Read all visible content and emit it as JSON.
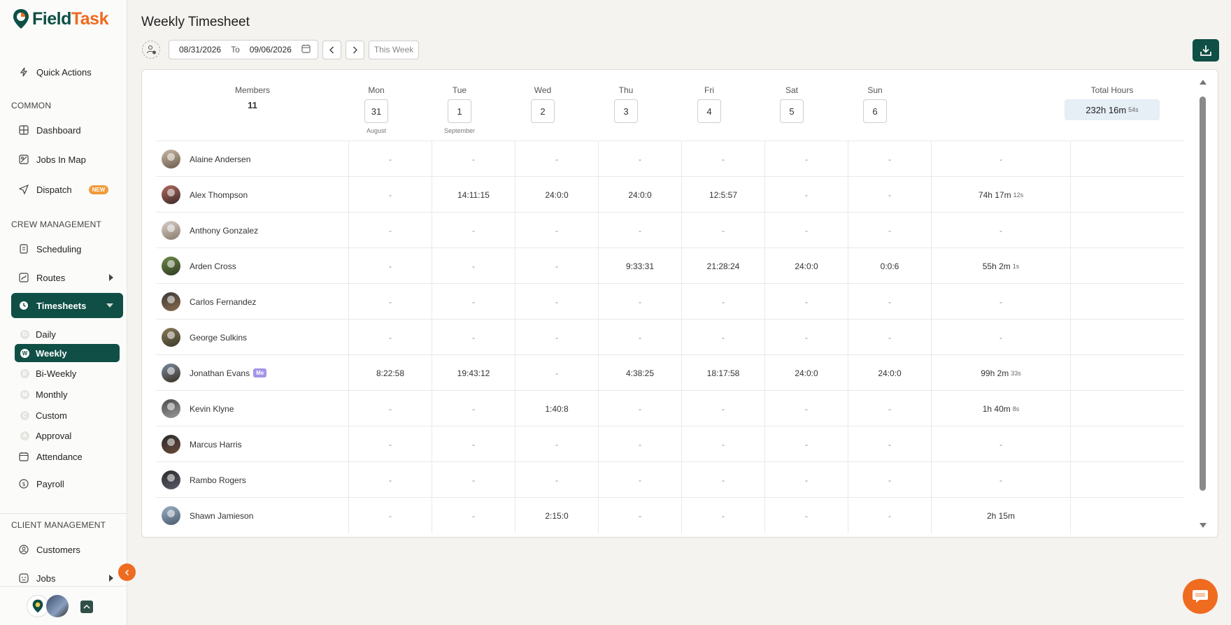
{
  "app": {
    "brand_part1": "Field",
    "brand_part2": "Task"
  },
  "sidebar": {
    "quick_actions": "Quick Actions",
    "section_common": "COMMON",
    "dashboard": "Dashboard",
    "jobs_in_map": "Jobs In Map",
    "dispatch": "Dispatch",
    "dispatch_badge": "NEW",
    "section_crew": "CREW MANAGEMENT",
    "scheduling": "Scheduling",
    "routes": "Routes",
    "timesheets": "Timesheets",
    "timesheet_sub": [
      {
        "letter": "D",
        "label": "Daily"
      },
      {
        "letter": "W",
        "label": "Weekly"
      },
      {
        "letter": "B",
        "label": "Bi-Weekly"
      },
      {
        "letter": "M",
        "label": "Monthly"
      },
      {
        "letter": "C",
        "label": "Custom"
      },
      {
        "letter": "A",
        "label": "Approval"
      }
    ],
    "attendance": "Attendance",
    "payroll": "Payroll",
    "section_client": "CLIENT MANAGEMENT",
    "customers": "Customers",
    "jobs": "Jobs"
  },
  "header": {
    "title": "Weekly Timesheet",
    "date_from": "08/31/2026",
    "to_label": "To",
    "date_to": "09/06/2026",
    "this_week": "This Week"
  },
  "table": {
    "members_label": "Members",
    "members_count": "11",
    "days": [
      {
        "name": "Mon",
        "num": "31",
        "month": "August"
      },
      {
        "name": "Tue",
        "num": "1",
        "month": "September"
      },
      {
        "name": "Wed",
        "num": "2",
        "month": ""
      },
      {
        "name": "Thu",
        "num": "3",
        "month": ""
      },
      {
        "name": "Fri",
        "num": "4",
        "month": ""
      },
      {
        "name": "Sat",
        "num": "5",
        "month": ""
      },
      {
        "name": "Sun",
        "num": "6",
        "month": ""
      }
    ],
    "total_label": "Total Hours",
    "total_main": "232h 16m",
    "total_small": "54s",
    "rows": [
      {
        "name": "Alaine Andersen",
        "me": "",
        "cells": [
          "-",
          "-",
          "-",
          "-",
          "-",
          "-",
          "-"
        ],
        "total": "-",
        "total_small": ""
      },
      {
        "name": "Alex Thompson",
        "me": "",
        "cells": [
          "-",
          "14:11:15",
          "24:0:0",
          "24:0:0",
          "12:5:57",
          "-",
          "-"
        ],
        "total": "74h 17m",
        "total_small": "12s"
      },
      {
        "name": "Anthony Gonzalez",
        "me": "",
        "cells": [
          "-",
          "-",
          "-",
          "-",
          "-",
          "-",
          "-"
        ],
        "total": "-",
        "total_small": ""
      },
      {
        "name": "Arden Cross",
        "me": "",
        "cells": [
          "-",
          "-",
          "-",
          "9:33:31",
          "21:28:24",
          "24:0:0",
          "0:0:6"
        ],
        "total": "55h 2m",
        "total_small": "1s"
      },
      {
        "name": "Carlos Fernandez",
        "me": "",
        "cells": [
          "-",
          "-",
          "-",
          "-",
          "-",
          "-",
          "-"
        ],
        "total": "-",
        "total_small": ""
      },
      {
        "name": "George Sulkins",
        "me": "",
        "cells": [
          "-",
          "-",
          "-",
          "-",
          "-",
          "-",
          "-"
        ],
        "total": "-",
        "total_small": ""
      },
      {
        "name": "Jonathan Evans",
        "me": "Me",
        "cells": [
          "8:22:58",
          "19:43:12",
          "-",
          "4:38:25",
          "18:17:58",
          "24:0:0",
          "24:0:0"
        ],
        "total": "99h 2m",
        "total_small": "33s"
      },
      {
        "name": "Kevin Klyne",
        "me": "",
        "cells": [
          "-",
          "-",
          "1:40:8",
          "-",
          "-",
          "-",
          "-"
        ],
        "total": "1h 40m",
        "total_small": "8s"
      },
      {
        "name": "Marcus Harris",
        "me": "",
        "cells": [
          "-",
          "-",
          "-",
          "-",
          "-",
          "-",
          "-"
        ],
        "total": "-",
        "total_small": ""
      },
      {
        "name": "Rambo Rogers",
        "me": "",
        "cells": [
          "-",
          "-",
          "-",
          "-",
          "-",
          "-",
          "-"
        ],
        "total": "-",
        "total_small": ""
      },
      {
        "name": "Shawn Jamieson",
        "me": "",
        "cells": [
          "-",
          "-",
          "2:15:0",
          "-",
          "-",
          "-",
          "-"
        ],
        "total": "2h 15m",
        "total_small": ""
      }
    ]
  },
  "colors": {
    "brand_green": "#0f4f45",
    "brand_orange": "#ef6b1f"
  }
}
